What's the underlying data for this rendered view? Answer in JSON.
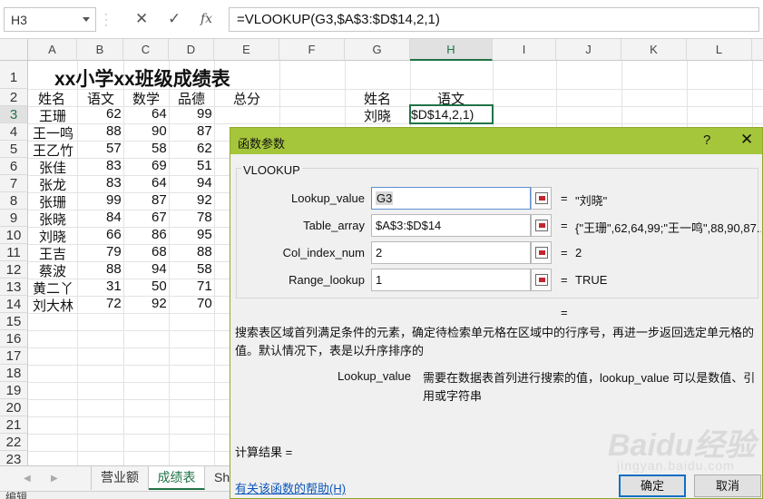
{
  "formula_bar": {
    "name_box": "H3",
    "cancel_icon": "✕",
    "enter_icon": "✓",
    "fx_label": "fx",
    "formula": "=VLOOKUP(G3,$A$3:$D$14,2,1)"
  },
  "columns": [
    "A",
    "B",
    "C",
    "D",
    "E",
    "F",
    "G",
    "H",
    "I",
    "J",
    "K",
    "L"
  ],
  "rows": [
    "1",
    "2",
    "3",
    "4",
    "5",
    "6",
    "7",
    "8",
    "9",
    "10",
    "11",
    "12",
    "13",
    "14",
    "15",
    "16",
    "17",
    "18",
    "19",
    "20",
    "21",
    "22",
    "23"
  ],
  "sheet": {
    "title": "xx小学xx班级成绩表",
    "headers": [
      "姓名",
      "语文",
      "数学",
      "品德",
      "总分"
    ],
    "students": [
      {
        "name": "王珊",
        "chinese": "62",
        "math": "64",
        "moral": "99"
      },
      {
        "name": "王一鸣",
        "chinese": "88",
        "math": "90",
        "moral": "87"
      },
      {
        "name": "王乙竹",
        "chinese": "57",
        "math": "58",
        "moral": "62"
      },
      {
        "name": "张佳",
        "chinese": "83",
        "math": "69",
        "moral": "51"
      },
      {
        "name": "张龙",
        "chinese": "83",
        "math": "64",
        "moral": "94"
      },
      {
        "name": "张珊",
        "chinese": "99",
        "math": "87",
        "moral": "92"
      },
      {
        "name": "张晓",
        "chinese": "84",
        "math": "67",
        "moral": "78"
      },
      {
        "name": "刘晓",
        "chinese": "66",
        "math": "86",
        "moral": "95"
      },
      {
        "name": "王吉",
        "chinese": "79",
        "math": "68",
        "moral": "88"
      },
      {
        "name": "蔡波",
        "chinese": "88",
        "math": "94",
        "moral": "58"
      },
      {
        "name": "黄二丫",
        "chinese": "31",
        "math": "50",
        "moral": "71"
      },
      {
        "name": "刘大林",
        "chinese": "72",
        "math": "92",
        "moral": "70"
      }
    ],
    "lookup_header_name": "姓名",
    "lookup_header_subject": "语文",
    "lookup_name": "刘晓",
    "active_cell_text": "$D$14,2,1)"
  },
  "sheet_tabs": {
    "tabs": [
      "营业额",
      "成绩表",
      "Sh"
    ],
    "active": "成绩表",
    "prev_icon": "◀",
    "next_icon": "▶"
  },
  "status_bar": {
    "mode": "编辑"
  },
  "dialog": {
    "title": "函数参数",
    "help_icon": "?",
    "close_icon": "✕",
    "function_name": "VLOOKUP",
    "args": [
      {
        "label": "Lookup_value",
        "value": "G3",
        "result": "\"刘晓\""
      },
      {
        "label": "Table_array",
        "value": "$A$3:$D$14",
        "result": "{\"王珊\",62,64,99;\"王一鸣\",88,90,87..."
      },
      {
        "label": "Col_index_num",
        "value": "2",
        "result": "2"
      },
      {
        "label": "Range_lookup",
        "value": "1",
        "result": "TRUE"
      }
    ],
    "equals": "=",
    "description": "搜索表区域首列满足条件的元素，确定待检索单元格在区域中的行序号，再进一步返回选定单元格的值。默认情况下，表是以升序排序的",
    "param_name": "Lookup_value",
    "param_description": "需要在数据表首列进行搜索的值，lookup_value 可以是数值、引用或字符串",
    "calc_result_label": "计算结果 =",
    "help_link": "有关该函数的帮助(H)",
    "ok_label": "确定",
    "cancel_label": "取消"
  },
  "watermark": {
    "brand": "Baidu经验",
    "domain": "jingyan.baidu.com"
  },
  "colors": {
    "excel_green": "#217346",
    "dialog_title_bar": "#a5c63b",
    "link_blue": "#0b56b8"
  }
}
